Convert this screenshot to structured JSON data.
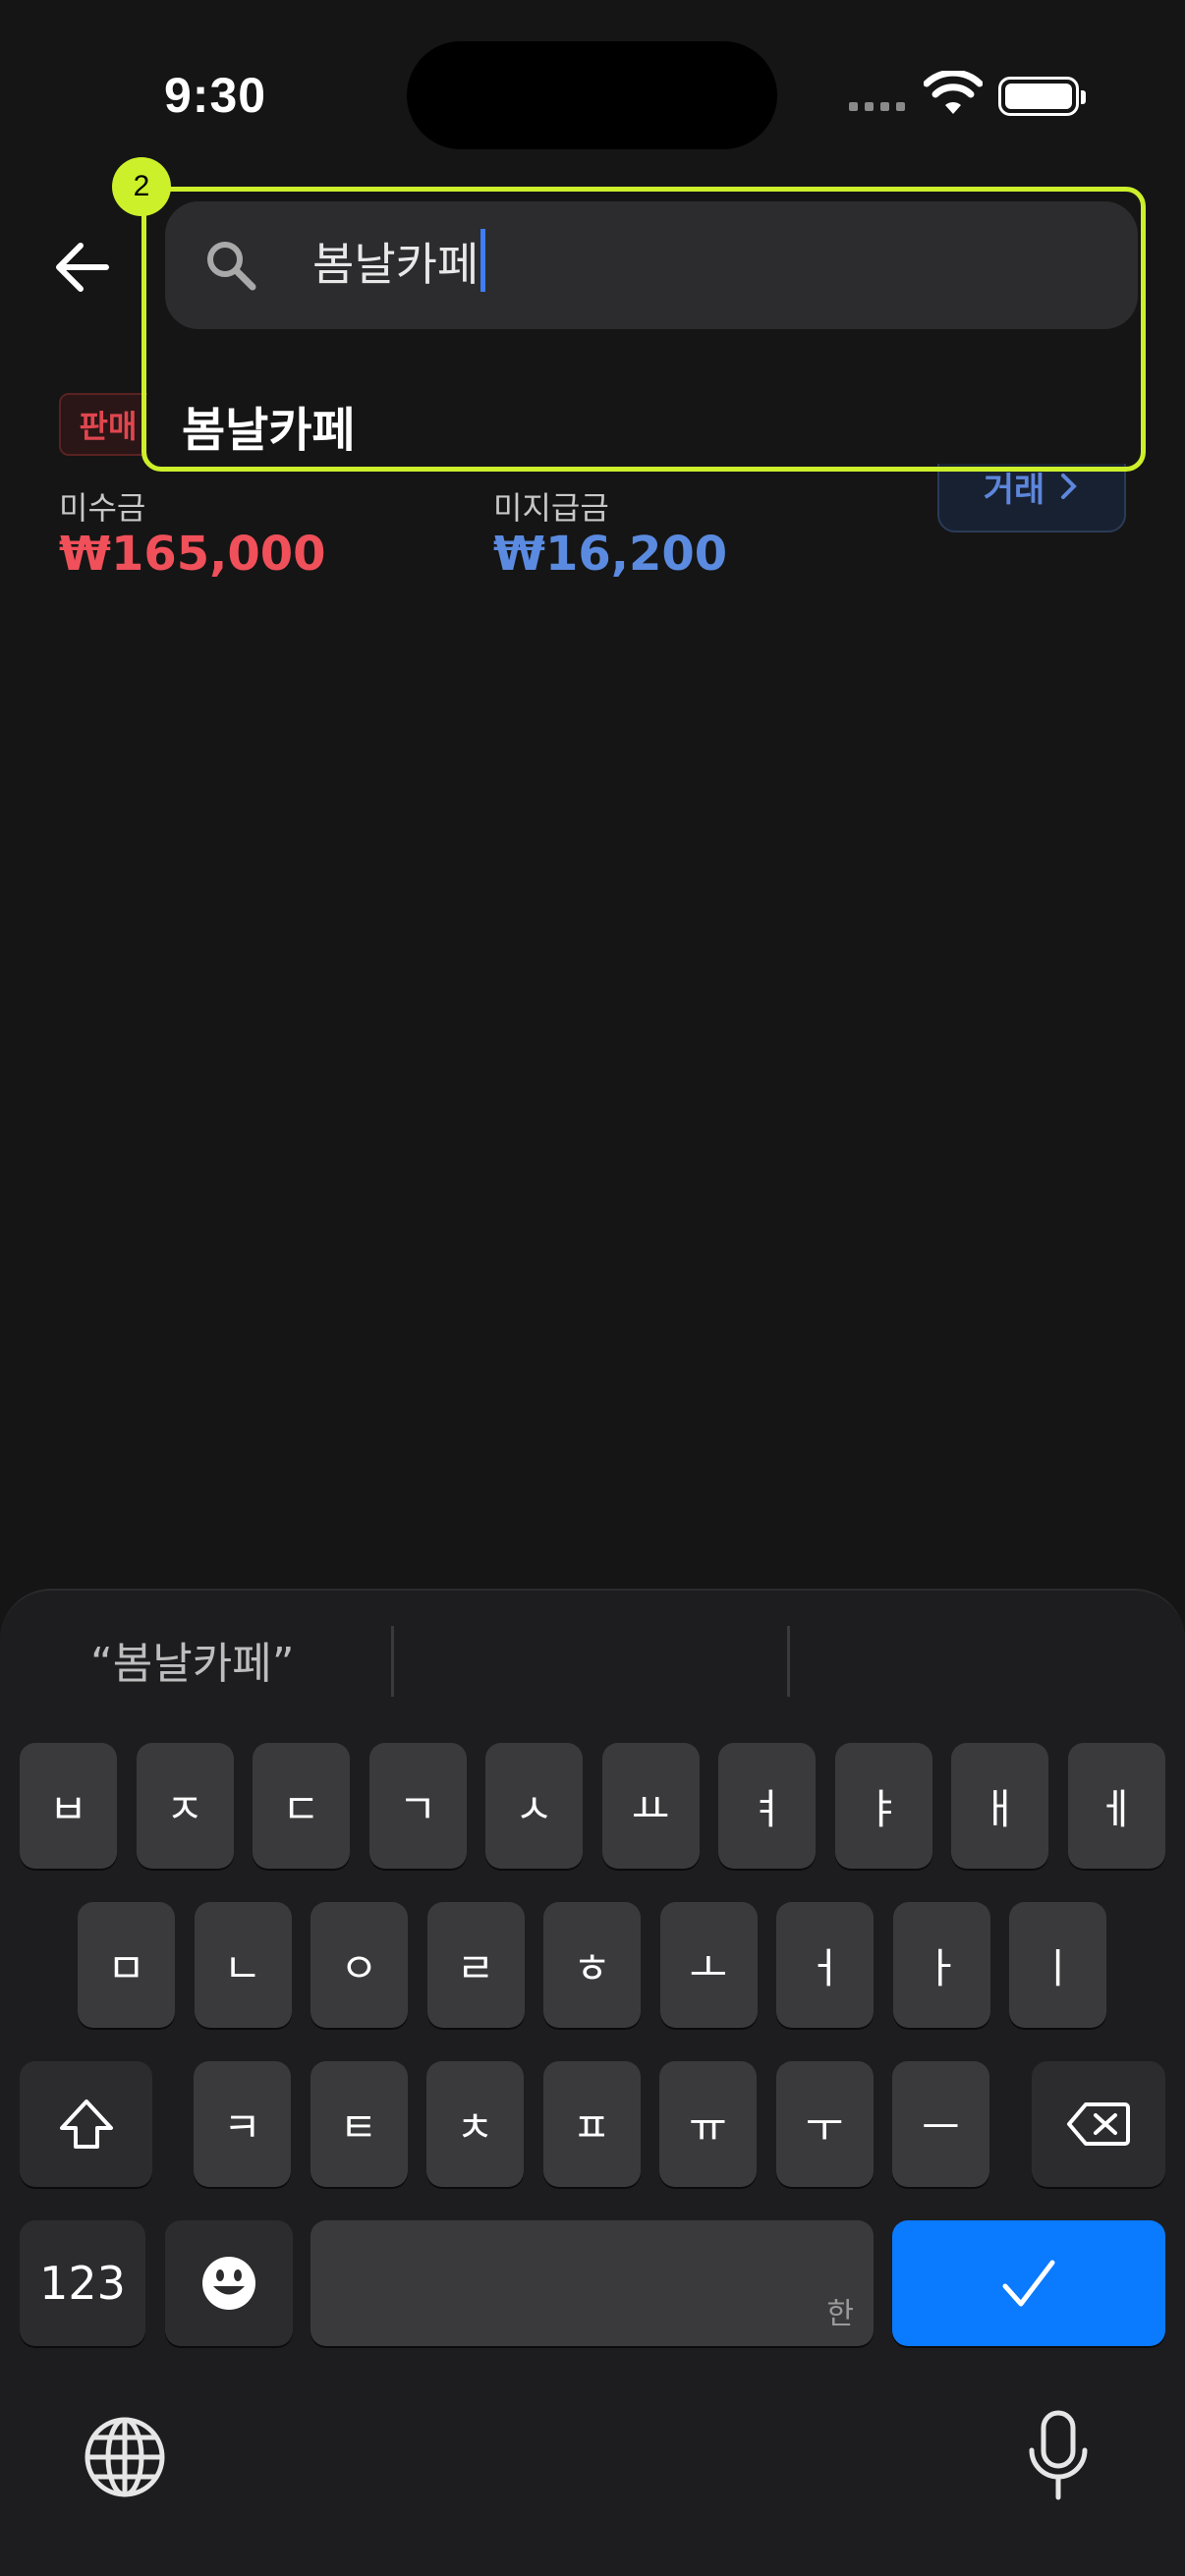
{
  "status_bar": {
    "time": "9:30"
  },
  "search": {
    "query": "봄날카페"
  },
  "suggestions": [
    "봄날카페"
  ],
  "content": {
    "badge": "판매",
    "receivable_label": "미수금",
    "receivable_value": "₩165,000",
    "payable_label": "미지급금",
    "payable_value": "₩16,200",
    "trade_button": "거래"
  },
  "annotation": {
    "number": "2",
    "color": "#ccf02a"
  },
  "keyboard": {
    "prediction": "“봄날카페”",
    "row1": [
      "ㅂ",
      "ㅈ",
      "ㄷ",
      "ㄱ",
      "ㅅ",
      "ㅛ",
      "ㅕ",
      "ㅑ",
      "ㅐ",
      "ㅔ"
    ],
    "row2": [
      "ㅁ",
      "ㄴ",
      "ㅇ",
      "ㄹ",
      "ㅎ",
      "ㅗ",
      "ㅓ",
      "ㅏ",
      "ㅣ"
    ],
    "row3": [
      "ㅋ",
      "ㅌ",
      "ㅊ",
      "ㅍ",
      "ㅠ",
      "ㅜ",
      "ㅡ"
    ],
    "numbers_label": "123",
    "space_hint": "한",
    "return_color": "#0a7aff"
  },
  "colors": {
    "background": "#151515",
    "receivable": "#f0505a",
    "payable": "#5b8be0"
  }
}
